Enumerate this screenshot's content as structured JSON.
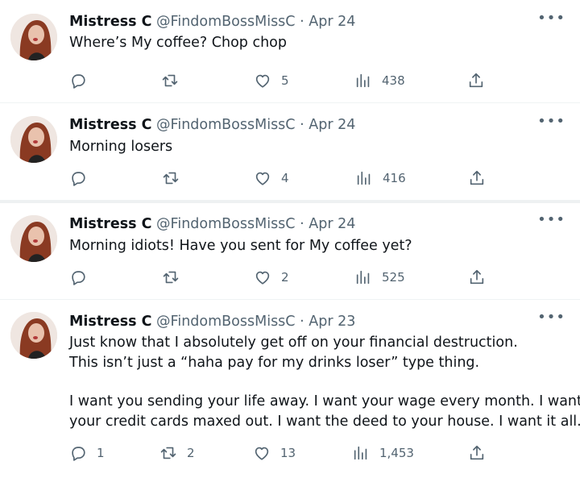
{
  "tweets": [
    {
      "name": "Mistress C",
      "handle": "@FindomBossMissC",
      "date": "Apr 24",
      "lines": [
        "Where’s My coffee? Chop chop"
      ],
      "replies": "",
      "retweets": "",
      "likes": "5",
      "views": "438"
    },
    {
      "name": "Mistress C",
      "handle": "@FindomBossMissC",
      "date": "Apr 24",
      "lines": [
        "Morning losers"
      ],
      "replies": "",
      "retweets": "",
      "likes": "4",
      "views": "416"
    },
    {
      "name": "Mistress C",
      "handle": "@FindomBossMissC",
      "date": "Apr 24",
      "lines": [
        "Morning idiots! Have you sent for My coffee yet?"
      ],
      "replies": "",
      "retweets": "",
      "likes": "2",
      "views": "525"
    },
    {
      "name": "Mistress C",
      "handle": "@FindomBossMissC",
      "date": "Apr 23",
      "lines": [
        "Just know that I absolutely get off on your financial destruction.",
        "This isn’t just a “haha pay for my drinks loser” type thing.",
        "",
        "I want you sending your life away. I want your wage every month. I want",
        "your credit cards maxed out. I want the deed to your house. I want it all."
      ],
      "replies": "1",
      "retweets": "2",
      "likes": "13",
      "views": "1,453"
    }
  ],
  "separator_dot": "·",
  "more_label": "•••",
  "icons": {
    "reply": "reply-icon",
    "retweet": "retweet-icon",
    "like": "heart-icon",
    "views": "views-icon",
    "share": "share-icon",
    "more": "more-icon"
  }
}
